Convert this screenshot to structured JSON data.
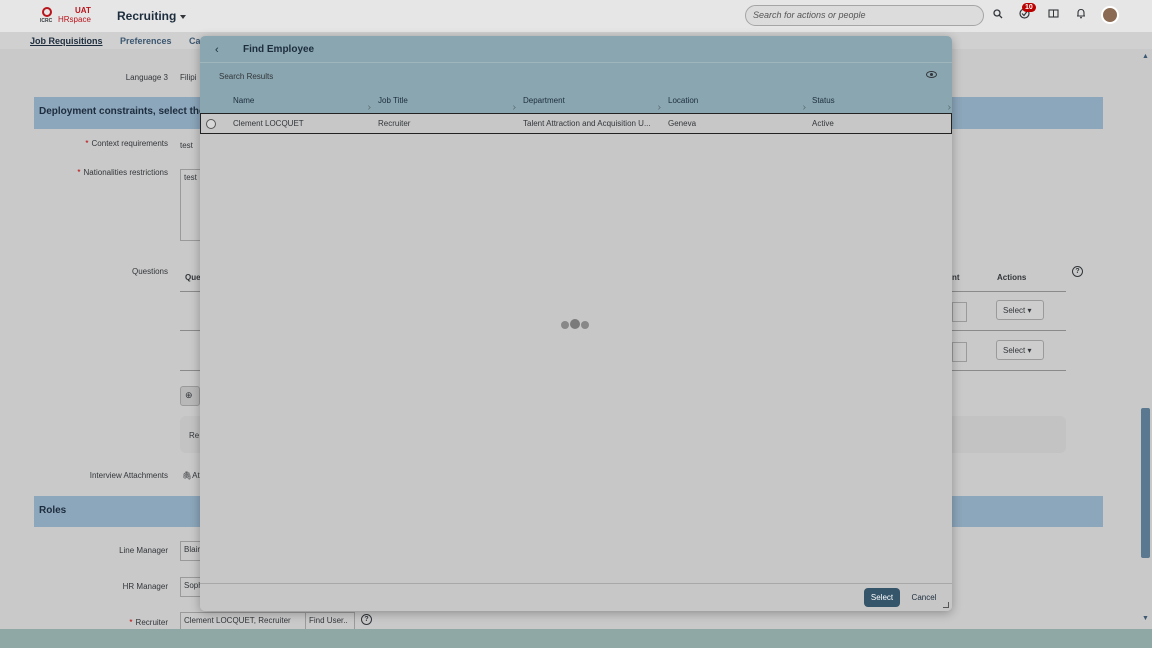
{
  "shell": {
    "logo_env": "UAT",
    "logo_text": "HRspace",
    "logo_org": "ICRC",
    "app_title": "Recruiting",
    "search_placeholder": "Search for actions or people",
    "notification_count": "10"
  },
  "nav": {
    "items": [
      {
        "label": "Job Requisitions"
      },
      {
        "label": "Preferences"
      },
      {
        "label": "Ca"
      }
    ]
  },
  "background": {
    "language3_label": "Language 3",
    "language3_value": "Filipi",
    "deployment_section": "Deployment constraints, select the",
    "context_label": "Context requirements",
    "context_value": "test",
    "nationalities_label": "Nationalities restrictions",
    "nationalities_value": "test",
    "questions_label": "Questions",
    "questions_col": "Que",
    "actions_col": "Actions",
    "nt_col": "nt",
    "select_label": "Select",
    "re_text": "Re",
    "interview_label": "Interview Attachments",
    "interview_value": "At",
    "roles_section": "Roles",
    "line_manager_label": "Line Manager",
    "line_manager_value": "Blair",
    "hr_manager_label": "HR Manager",
    "hr_manager_value": "Soph",
    "recruiter_label": "Recruiter",
    "recruiter_value": "Clement LOCQUET, Recruiter",
    "find_user_label": "Find User.."
  },
  "dialog": {
    "title": "Find Employee",
    "subtitle": "Search Results",
    "columns": [
      "Name",
      "Job Title",
      "Department",
      "Location",
      "Status"
    ],
    "rows": [
      {
        "name": "Clement LOCQUET",
        "job_title": "Recruiter",
        "department": "Talent Attraction and Acquisition U...",
        "location": "Geneva",
        "status": "Active"
      }
    ],
    "select_label": "Select",
    "cancel_label": "Cancel"
  }
}
